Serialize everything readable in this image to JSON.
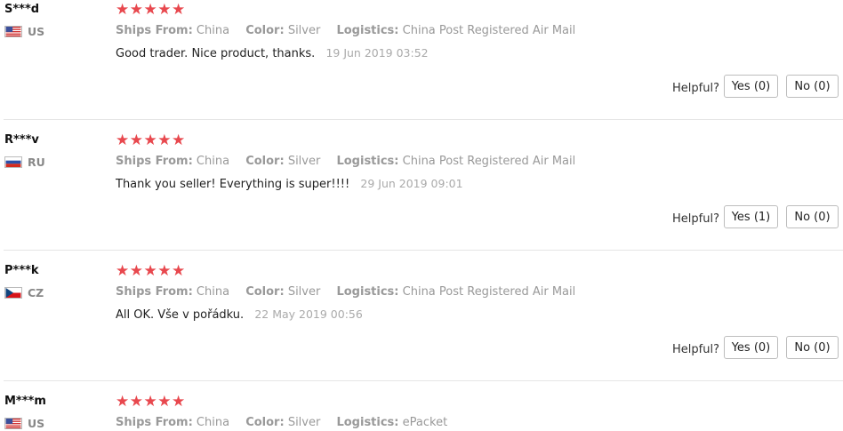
{
  "labels": {
    "ships_from": "Ships From:",
    "color": "Color:",
    "logistics": "Logistics:",
    "helpful": "Helpful?"
  },
  "reviews": [
    {
      "name": "S***d",
      "country": "US",
      "flag": "us-flag-icon",
      "stars": "★★★★★",
      "ships_from": "China",
      "color": "Silver",
      "logistics": "China Post Registered Air Mail",
      "text": "Good trader. Nice product, thanks.",
      "date": "19 Jun 2019 03:52",
      "yes": "Yes (0)",
      "no": "No (0)"
    },
    {
      "name": "R***v",
      "country": "RU",
      "flag": "ru-flag-icon",
      "stars": "★★★★★",
      "ships_from": "China",
      "color": "Silver",
      "logistics": "China Post Registered Air Mail",
      "text": "Thank you seller! Everything is super!!!!",
      "date": "29 Jun 2019 09:01",
      "yes": "Yes (1)",
      "no": "No (0)"
    },
    {
      "name": "P***k",
      "country": "CZ",
      "flag": "cz-flag-icon",
      "stars": "★★★★★",
      "ships_from": "China",
      "color": "Silver",
      "logistics": "China Post Registered Air Mail",
      "text": "All OK. Vše v pořádku.",
      "date": "22 May 2019 00:56",
      "yes": "Yes (0)",
      "no": "No (0)"
    },
    {
      "name": "M***m",
      "country": "US",
      "flag": "us-flag-icon",
      "stars": "★★★★★",
      "ships_from": "China",
      "color": "Silver",
      "logistics": "ePacket"
    }
  ],
  "colors": {
    "star": "#e8484e",
    "muted_text": "#999999",
    "border": "#bdbdbd"
  }
}
